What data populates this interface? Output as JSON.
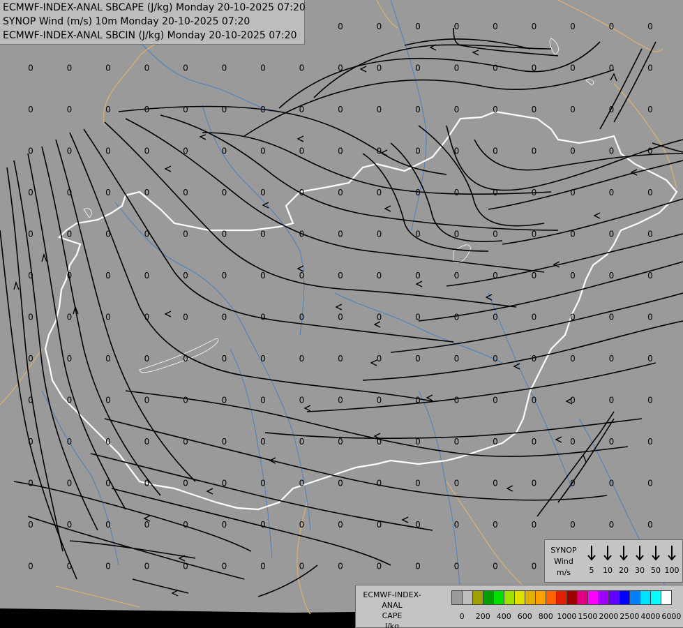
{
  "header": {
    "line1": "ECMWF-INDEX-ANAL SBCAPE (J/kg) Monday 20-10-2025 07:20",
    "line2": "SYNOP Wind (m/s) 10m Monday 20-10-2025 07:20",
    "line3": "ECMWF-INDEX-ANAL SBCIN (J/kg) Monday 20-10-2025 07:20"
  },
  "grid_value": "0",
  "wind_legend": {
    "title_line1": "SYNOP",
    "title_line2": "Wind",
    "title_line3": "m/s",
    "speeds": [
      "5",
      "10",
      "20",
      "30",
      "50",
      "100"
    ]
  },
  "cape_legend": {
    "title_line1": "ECMWF-INDEX-ANAL",
    "title_line2": "CAPE",
    "title_line3": "J/kg",
    "labels": [
      "0",
      "200",
      "400",
      "600",
      "800",
      "1000",
      "1500",
      "2000",
      "2500",
      "4000",
      "6000"
    ],
    "colors": [
      "#9a9a9a",
      "#bdbdbd",
      "#a0a000",
      "#00a000",
      "#00e000",
      "#a0e000",
      "#e0e000",
      "#e0b000",
      "#ffa000",
      "#ff6000",
      "#e02000",
      "#a00000",
      "#e00080",
      "#ff00ff",
      "#a000ff",
      "#6000ff",
      "#0000ff",
      "#0080ff",
      "#00e0ff",
      "#00ffff",
      "#ffffff"
    ]
  },
  "map_colors": {
    "background": "#9a9a9a",
    "outside": "#000000",
    "border_main": "#ffffff",
    "border_other": "#d8b074",
    "rivers": "#4a7fc0",
    "streamlines": "#000000"
  }
}
